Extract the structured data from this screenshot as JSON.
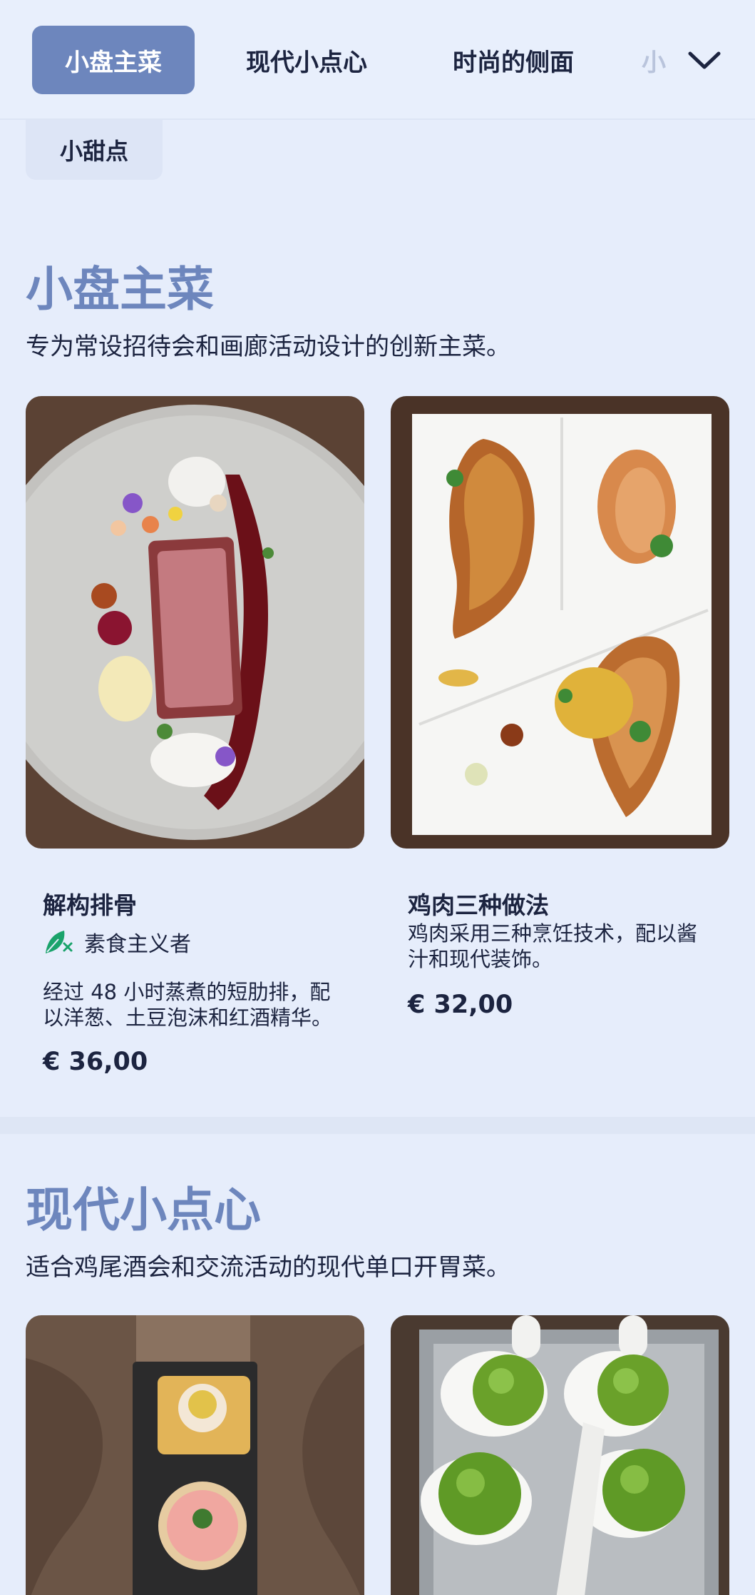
{
  "nav": {
    "tabs": [
      {
        "label": "小盘主菜",
        "active": true
      },
      {
        "label": "现代小点心",
        "active": false
      },
      {
        "label": "时尚的侧面",
        "active": false
      },
      {
        "label": "小",
        "active": false
      }
    ],
    "overflow_tab": "小甜点",
    "expand_icon": "chevron-down-icon"
  },
  "sections": [
    {
      "title": "小盘主菜",
      "description": "专为常设招待会和画廊活动设计的创新主菜。",
      "dishes": [
        {
          "name": "解构排骨",
          "tag": "素食主义者",
          "tag_icon": "vegetarian-leaf-icon",
          "description": "经过 48 小时蒸煮的短肋排，配以洋葱、土豆泡沫和红酒精华。",
          "price": "€ 36,00"
        },
        {
          "name": "鸡肉三种做法",
          "description": "鸡肉采用三种烹饪技术，配以酱汁和现代装饰。",
          "price": "€ 32,00"
        }
      ]
    },
    {
      "title": "现代小点心",
      "description": "适合鸡尾酒会和交流活动的现代单口开胃菜。"
    }
  ],
  "colors": {
    "background": "#e6edfb",
    "accent": "#6d86bd",
    "text": "#1c2440",
    "tag_green": "#1aa36b"
  }
}
